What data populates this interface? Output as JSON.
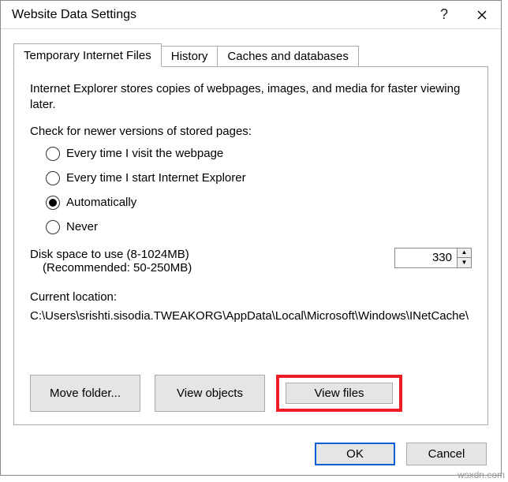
{
  "title": "Website Data Settings",
  "tabs": [
    {
      "label": "Temporary Internet Files",
      "active": true
    },
    {
      "label": "History",
      "active": false
    },
    {
      "label": "Caches and databases",
      "active": false
    }
  ],
  "description": "Internet Explorer stores copies of webpages, images, and media for faster viewing later.",
  "check_label": "Check for newer versions of stored pages:",
  "radios": {
    "every_visit": "Every time I visit the webpage",
    "every_start": "Every time I start Internet Explorer",
    "automatically": "Automatically",
    "never": "Never",
    "selected": "automatically"
  },
  "disk": {
    "label": "Disk space to use (8-1024MB)",
    "recommended": "(Recommended: 50-250MB)",
    "value": "330"
  },
  "location": {
    "label": "Current location:",
    "path": "C:\\Users\\srishti.sisodia.TWEAKORG\\AppData\\Local\\Microsoft\\Windows\\INetCache\\"
  },
  "buttons": {
    "move_folder": "Move folder...",
    "view_objects": "View objects",
    "view_files": "View files",
    "ok": "OK",
    "cancel": "Cancel"
  },
  "watermark": "wsxdn.com"
}
